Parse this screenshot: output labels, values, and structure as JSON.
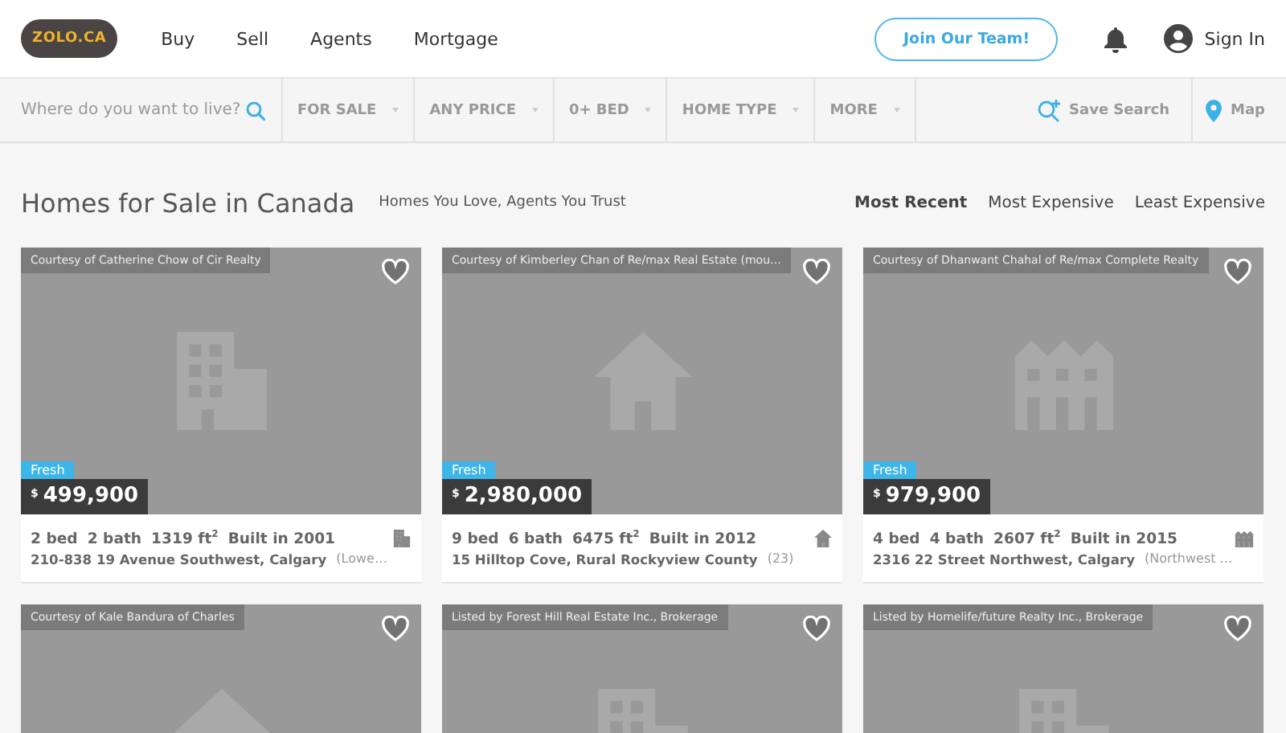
{
  "header": {
    "logo": "ZOLO.CA",
    "nav": [
      "Buy",
      "Sell",
      "Agents",
      "Mortgage"
    ],
    "cta": "Join Our Team!",
    "sign_in": "Sign In"
  },
  "filters": {
    "search": {
      "placeholder": "Where do you want to live?"
    },
    "dropdowns": [
      "FOR SALE",
      "ANY PRICE",
      "0+ BED",
      "HOME TYPE",
      "MORE"
    ],
    "save_search": "Save Search",
    "map": "Map"
  },
  "page": {
    "title": "Homes for Sale in Canada",
    "tagline": "Homes You Love, Agents You Trust",
    "sort": [
      {
        "label": "Most Recent",
        "selected": true
      },
      {
        "label": "Most Expensive",
        "selected": false
      },
      {
        "label": "Least Expensive",
        "selected": false
      }
    ]
  },
  "listings": [
    {
      "courtesy": "Courtesy of Catherine Chow of Cir Realty",
      "kind": "condo",
      "badge": "Fresh",
      "currency": "$",
      "price": "499,900",
      "stats": [
        "2 bed",
        "2 bath",
        "1319 ft$^{2}$",
        "Built in 2001"
      ],
      "address": "210-838 19 Avenue Southwest, Calgary",
      "area": "(Lowe…"
    },
    {
      "courtesy": "Courtesy of Kimberley Chan of Re/max Real Estate (mou…",
      "kind": "house",
      "badge": "Fresh",
      "currency": "$",
      "price": "2,980,000",
      "stats": [
        "9 bed",
        "6 bath",
        "6475 ft$^{2}$",
        "Built in 2012"
      ],
      "address": "15 Hilltop Cove, Rural Rockyview County",
      "area": "(23)"
    },
    {
      "courtesy": "Courtesy of Dhanwant Chahal of Re/max Complete Realty",
      "kind": "townhouse",
      "badge": "Fresh",
      "currency": "$",
      "price": "979,900",
      "stats": [
        "4 bed",
        "4 bath",
        "2607 ft$^{2}$",
        "Built in 2015"
      ],
      "address": "2316 22 Street Northwest, Calgary",
      "area": "(Northwest …"
    },
    {
      "courtesy": "Courtesy of Kale Bandura of Charles",
      "kind": "house"
    },
    {
      "courtesy": "Listed by Forest Hill Real Estate Inc., Brokerage",
      "kind": "condo"
    },
    {
      "courtesy": "Listed by Homelife/future Realty Inc., Brokerage",
      "kind": "condo"
    }
  ]
}
